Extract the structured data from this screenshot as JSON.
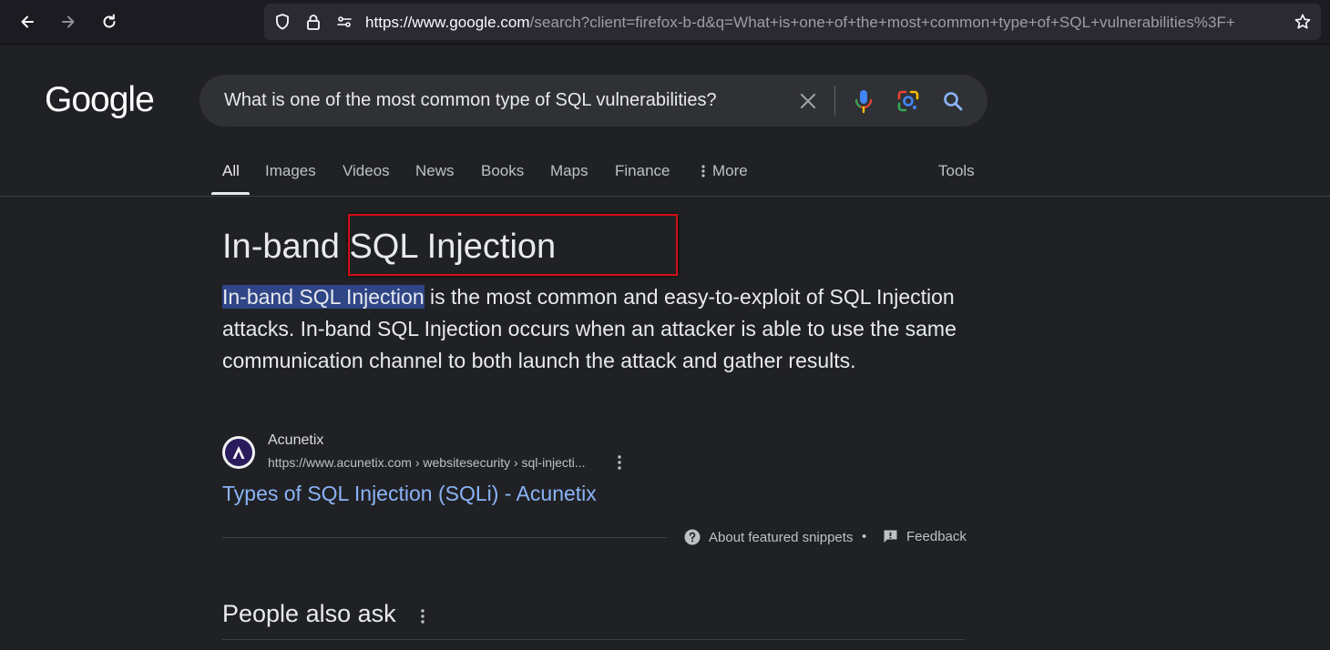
{
  "browser": {
    "url_host": "https://www.google.com",
    "url_path": "/search?client=firefox-b-d&q=What+is+one+of+the+most+common+type+of+SQL+vulnerabilities%3F+"
  },
  "google": {
    "logo": "Google",
    "search_query": "What is one of the most common type of SQL vulnerabilities?"
  },
  "tabs": [
    {
      "label": "All"
    },
    {
      "label": "Images"
    },
    {
      "label": "Videos"
    },
    {
      "label": "News"
    },
    {
      "label": "Books"
    },
    {
      "label": "Maps"
    },
    {
      "label": "Finance"
    },
    {
      "label": "More"
    },
    {
      "label": "Tools"
    }
  ],
  "snippet": {
    "title_prefix": "In-band",
    "title_highlight": "SQL Injection",
    "body_highlight": "In-band SQL Injection",
    "body_rest": " is the most common and easy-to-exploit of SQL Injection attacks. In-band SQL Injection occurs when an attacker is able to use the same communication channel to both launch the attack and gather results.",
    "source_name": "Acunetix",
    "source_url": "https://www.acunetix.com › websitesecurity › sql-injecti...",
    "link_text": "Types of SQL Injection (SQLi) - Acunetix",
    "about_label": "About featured snippets",
    "separator": "•",
    "feedback_label": "Feedback"
  },
  "people_also_ask": {
    "title": "People also ask"
  },
  "colors": {
    "background": "#202124",
    "link": "#8ab4f8",
    "selection": "#2f4586",
    "annotation_box": "#d00f16"
  }
}
